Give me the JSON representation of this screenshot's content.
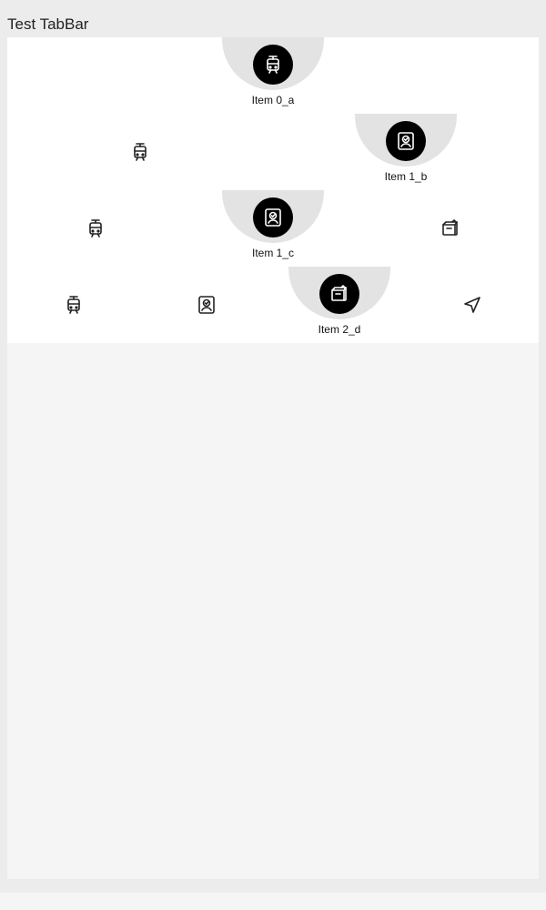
{
  "app": {
    "title": "Test TabBar"
  },
  "tabbars": [
    {
      "tabs": [
        {
          "icon": "tram-icon",
          "label": "Item 0_a",
          "selected": true
        }
      ]
    },
    {
      "tabs": [
        {
          "icon": "tram-icon",
          "label": "",
          "selected": false
        },
        {
          "icon": "badge-check-icon",
          "label": "Item 1_b",
          "selected": true
        }
      ]
    },
    {
      "tabs": [
        {
          "icon": "tram-icon",
          "label": "",
          "selected": false
        },
        {
          "icon": "badge-check-icon",
          "label": "Item 1_c",
          "selected": true
        },
        {
          "icon": "package-icon",
          "label": "",
          "selected": false
        }
      ]
    },
    {
      "tabs": [
        {
          "icon": "tram-icon",
          "label": "",
          "selected": false
        },
        {
          "icon": "badge-check-icon",
          "label": "",
          "selected": false
        },
        {
          "icon": "package-icon",
          "label": "Item 2_d",
          "selected": true
        },
        {
          "icon": "navigation-arrow-icon",
          "label": "",
          "selected": false
        }
      ]
    }
  ],
  "colors": {
    "page_background": "#ececec",
    "content_background": "#f5f5f5",
    "tabbar_background": "#ffffff",
    "notch": "#e3e3e3",
    "selected_bubble": "#000000"
  }
}
